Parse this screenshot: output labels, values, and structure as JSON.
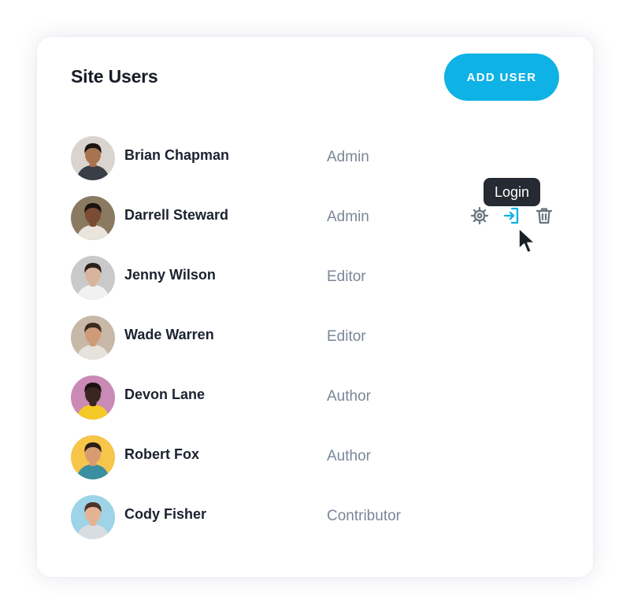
{
  "panel": {
    "title": "Site Users",
    "add_button_label": "ADD USER"
  },
  "users": [
    {
      "name": "Brian Chapman",
      "role": "Admin",
      "avatar_bg": "#d9d4cd",
      "skin": "#a8734f",
      "hair": "#1b1410",
      "shirt": "#3a3f47"
    },
    {
      "name": "Darrell Steward",
      "role": "Admin",
      "avatar_bg": "#8a7a62",
      "skin": "#7a4c33",
      "hair": "#1a120d",
      "shirt": "#e9e4dc"
    },
    {
      "name": "Jenny Wilson",
      "role": "Editor",
      "avatar_bg": "#c9c9c9",
      "skin": "#d9b49c",
      "hair": "#2a211c",
      "shirt": "#f1f1f1"
    },
    {
      "name": "Wade Warren",
      "role": "Editor",
      "avatar_bg": "#c7b8a8",
      "skin": "#cf9a78",
      "hair": "#3a2a20",
      "shirt": "#e6e2dc"
    },
    {
      "name": "Devon Lane",
      "role": "Author",
      "avatar_bg": "#c98ab5",
      "skin": "#3a2620",
      "hair": "#1a1210",
      "shirt": "#f5c926"
    },
    {
      "name": "Robert Fox",
      "role": "Author",
      "avatar_bg": "#f6c54a",
      "skin": "#d89b72",
      "hair": "#2a1d16",
      "shirt": "#3a8fa0"
    },
    {
      "name": "Cody Fisher",
      "role": "Contributor",
      "avatar_bg": "#9ed3e8",
      "skin": "#e3b393",
      "hair": "#4a3428",
      "shirt": "#d8dde2"
    }
  ],
  "row_actions": {
    "settings_icon": "gear-icon",
    "login_icon": "login-icon",
    "delete_icon": "trash-icon",
    "tooltip_label": "Login"
  },
  "colors": {
    "accent": "#0fb2e4",
    "icon_gray": "#6b7280",
    "tooltip_bg": "#252a33"
  }
}
